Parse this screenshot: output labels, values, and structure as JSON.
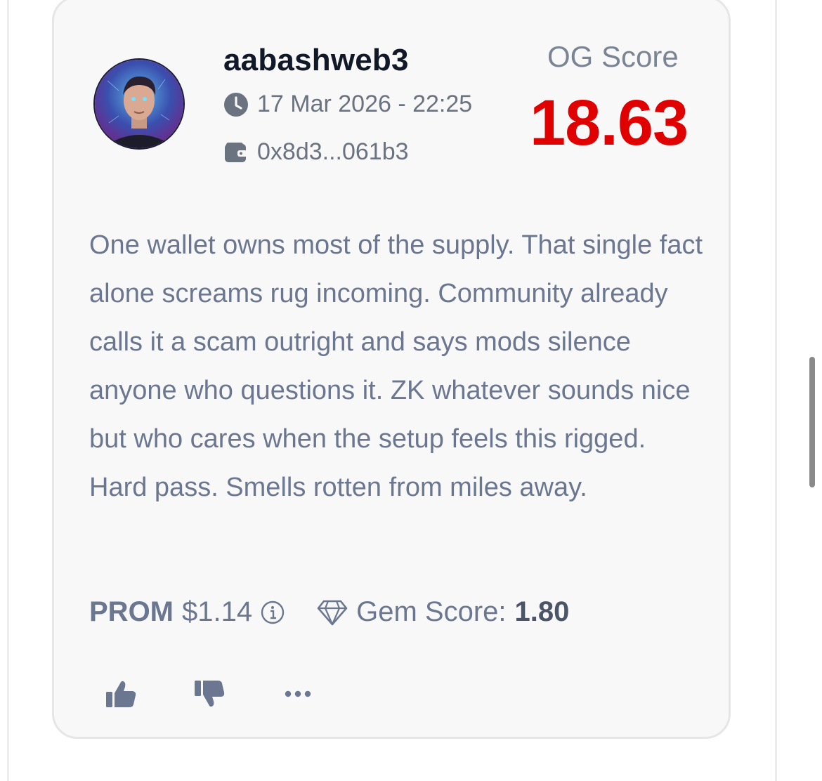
{
  "post": {
    "username": "aabashweb3",
    "date": "17 Mar 2026 - 22:25",
    "wallet": "0x8d3...061b3",
    "og_score_label": "OG Score",
    "og_score_value": "18.63",
    "body": "One wallet owns most of the supply. That single fact alone screams rug incoming. Community already calls it a scam outright and says mods silence anyone who questions it. ZK whatever sounds nice but who cares when the setup feels this rigged. Hard pass. Smells rotten from miles away.",
    "prom_label": "PROM",
    "prom_value": "$1.14",
    "gem_label": "Gem Score:",
    "gem_value": "1.80"
  },
  "icons": {
    "avatar": "avatar-image",
    "date": "clock-icon",
    "wallet": "wallet-icon",
    "info": "info-icon",
    "gem": "diamond-icon",
    "like": "thumbs-up-icon",
    "dislike": "thumbs-down-icon",
    "more": "more-dots-icon"
  },
  "colors": {
    "og_score": "#e00000",
    "username": "#111827",
    "muted_text": "#6b7791",
    "card_bg": "#f8f8f8"
  }
}
